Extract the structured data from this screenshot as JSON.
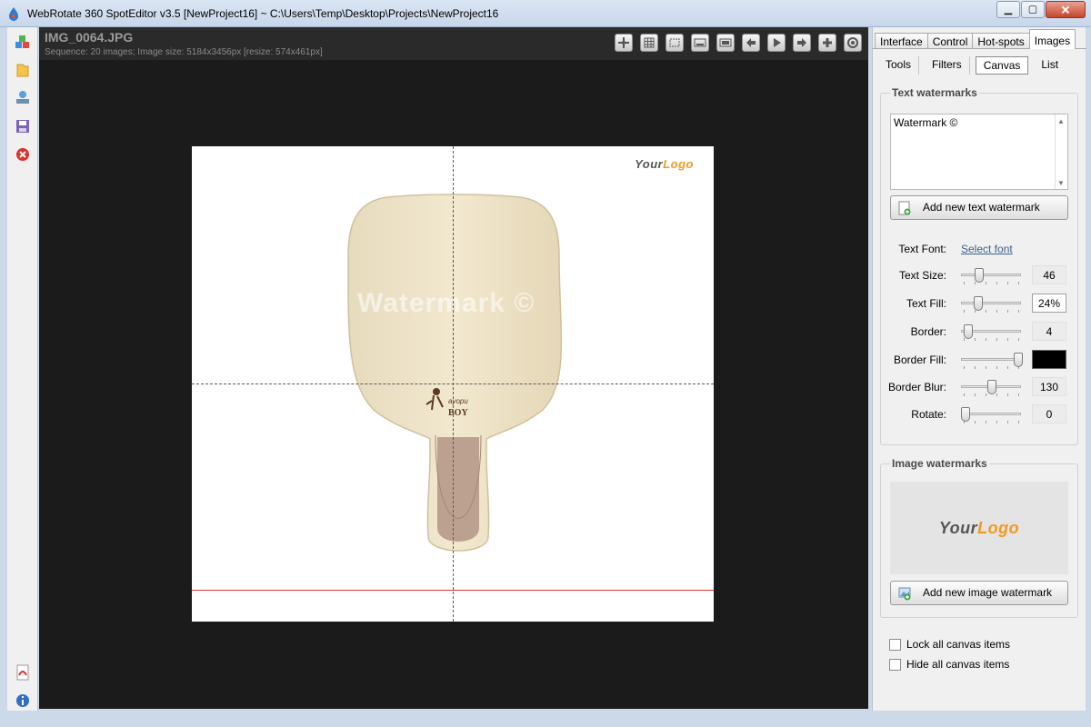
{
  "window": {
    "title": "WebRotate 360 SpotEditor v3.5 [NewProject16] ~ C:\\Users\\Temp\\Desktop\\Projects\\NewProject16",
    "minimize": "▁",
    "maximize": "▢",
    "close": "✕"
  },
  "viewer": {
    "image_name": "IMG_0064.JPG",
    "sequence_info": "Sequence: 20 images; Image size: 5184x3456px [resize: 574x461px]",
    "watermark_preview": "Watermark ©",
    "logo_part1": "Your",
    "logo_part2": "Logo",
    "product_text_line1": "ayopu",
    "product_text_line2": "BOY"
  },
  "tabs": [
    {
      "label": "Interface"
    },
    {
      "label": "Control"
    },
    {
      "label": "Hot-spots"
    },
    {
      "label": "Images"
    }
  ],
  "subtabs": [
    {
      "label": "Tools"
    },
    {
      "label": "Filters"
    },
    {
      "label": "Canvas"
    },
    {
      "label": "List"
    }
  ],
  "text_watermarks": {
    "title": "Text watermarks",
    "items": [
      "Watermark ©"
    ],
    "add_button": "Add new text watermark",
    "font_label": "Text Font:",
    "font_link": "Select font",
    "params": [
      {
        "label": "Text Size:",
        "value": "46",
        "level": 0.25
      },
      {
        "label": "Text Fill:",
        "value": "24%",
        "level": 0.24
      },
      {
        "label": "Border:",
        "value": "4",
        "level": 0.05
      },
      {
        "label": "Border Fill:",
        "value": "",
        "level": 1.0
      },
      {
        "label": "Border Blur:",
        "value": "130",
        "level": 0.5
      },
      {
        "label": "Rotate:",
        "value": "0",
        "level": 0.0
      }
    ]
  },
  "image_watermarks": {
    "title": "Image watermarks",
    "logo_part1": "Your",
    "logo_part2": "Logo",
    "add_button": "Add new image watermark"
  },
  "options": {
    "lock_label": "Lock all canvas items",
    "hide_label": "Hide all canvas items"
  },
  "colors": {
    "accent_logo": "#f29a1e",
    "border_fill": "#000000",
    "guide_red": "#d93b3b"
  }
}
